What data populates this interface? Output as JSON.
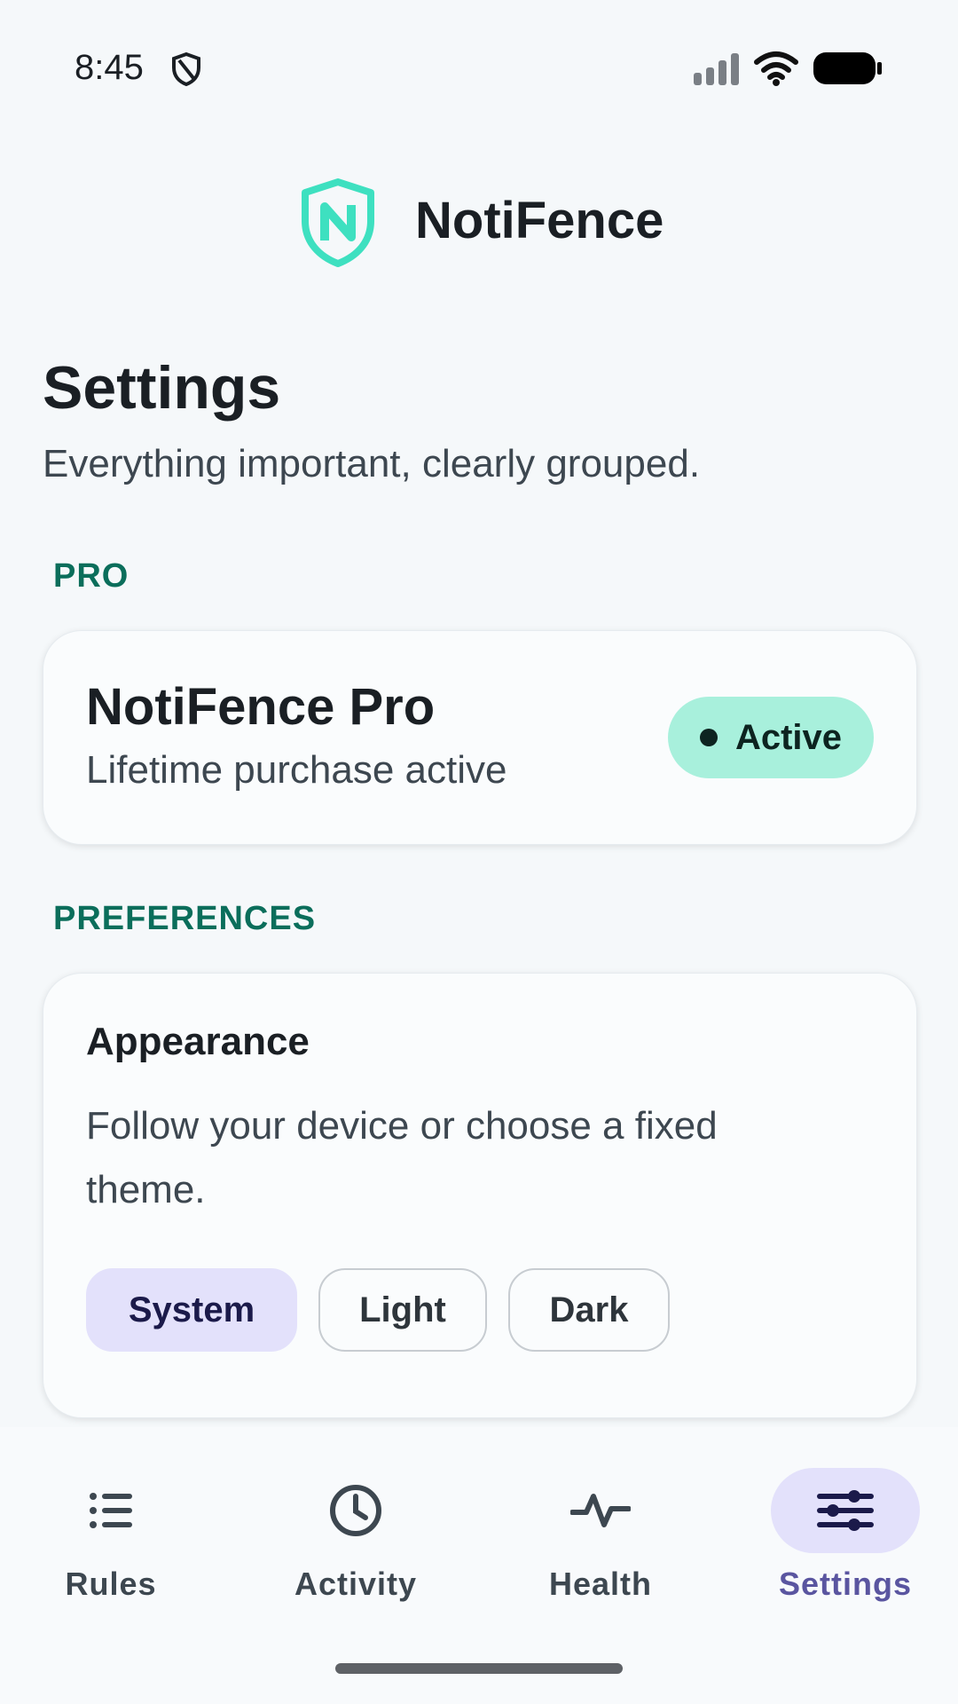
{
  "status_bar": {
    "time": "8:45"
  },
  "header": {
    "app_name": "NotiFence"
  },
  "page": {
    "title": "Settings",
    "subtitle": "Everything important, clearly grouped."
  },
  "sections": {
    "pro": {
      "label": "PRO",
      "card_title": "NotiFence Pro",
      "card_subtitle": "Lifetime purchase active",
      "badge": "Active"
    },
    "preferences": {
      "label": "PREFERENCES",
      "appearance": {
        "title": "Appearance",
        "description": "Follow your device or choose a fixed theme.",
        "options": [
          "System",
          "Light",
          "Dark"
        ],
        "selected": "System"
      }
    }
  },
  "bottom_nav": {
    "items": [
      {
        "label": "Rules",
        "icon": "list-icon"
      },
      {
        "label": "Activity",
        "icon": "clock-icon"
      },
      {
        "label": "Health",
        "icon": "pulse-icon"
      },
      {
        "label": "Settings",
        "icon": "sliders-icon"
      }
    ],
    "active": "Settings"
  },
  "colors": {
    "accent_green": "#0B6E5B",
    "badge_bg": "#A8F0DC",
    "selection_bg": "#E3E1FB",
    "logo": "#3EE0C0"
  }
}
